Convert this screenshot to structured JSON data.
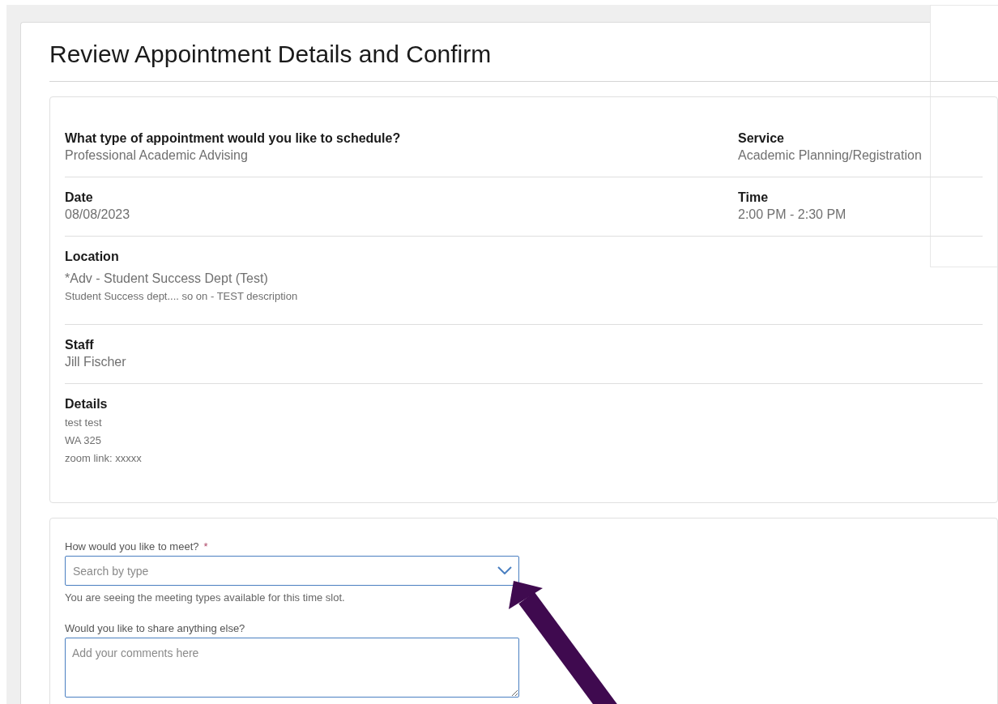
{
  "page_title": "Review Appointment Details and Confirm",
  "detail_rows": [
    {
      "fields": [
        {
          "label": "What type of appointment would you like to schedule?",
          "value": "Professional Academic Advising"
        },
        {
          "label": "Service",
          "value": "Academic Planning/Registration"
        }
      ]
    },
    {
      "fields": [
        {
          "label": "Date",
          "value": "08/08/2023"
        },
        {
          "label": "Time",
          "value": "2:00 PM - 2:30 PM"
        }
      ]
    },
    {
      "fields": [
        {
          "label": "Location",
          "value": "*Adv - Student Success Dept (Test)",
          "note": "Student Success dept.... so on - TEST description"
        }
      ]
    },
    {
      "fields": [
        {
          "label": "Staff",
          "value": "Jill Fischer"
        }
      ]
    },
    {
      "fields": [
        {
          "label": "Details",
          "lines": [
            "test test",
            "WA 325",
            "zoom link: xxxxx"
          ]
        }
      ]
    }
  ],
  "form": {
    "meeting": {
      "label": "How would you like to meet?",
      "required_mark": "*",
      "placeholder": "Search by type",
      "hint": "You are seeing the meeting types available for this time slot."
    },
    "comments": {
      "label": "Would you like to share anything else?",
      "placeholder": "Add your comments here"
    }
  }
}
